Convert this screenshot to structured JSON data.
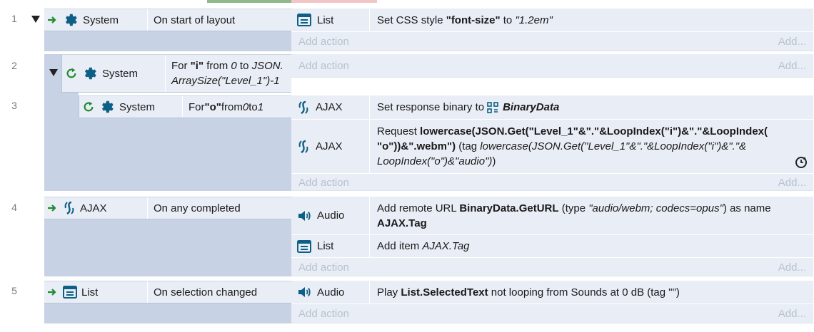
{
  "events": [
    {
      "num": "1",
      "condition": {
        "object": "System",
        "text": "On start of layout"
      },
      "actions": [
        {
          "object": "List",
          "prefix": "Set CSS style ",
          "prop": "\"font-size\"",
          "mid": " to ",
          "val": "\"1.2em\""
        }
      ]
    },
    {
      "num": "2",
      "condition": {
        "object": "System",
        "text_a": "For ",
        "var": "\"i\"",
        "text_b": " from ",
        "from": "0",
        "text_c": " to ",
        "to_line1": "JSON.",
        "to_line2": "ArraySize(\"Level_1\")-1"
      }
    },
    {
      "num": "3",
      "condition": {
        "object": "System",
        "text_a": "For ",
        "var": "\"o\"",
        "text_b": " from ",
        "from": "0",
        "text_c": " to ",
        "to": "1"
      },
      "actions": [
        {
          "object": "AJAX",
          "prefix": "Set response binary to ",
          "target": "BinaryData"
        },
        {
          "object": "AJAX",
          "prefix": "Request ",
          "expr1": "lowercase(JSON.Get(\"Level_1\"&\".\"&LoopIndex(\"i\")&\".\"&LoopIndex(",
          "expr2": "\"o\"))&\".webm\")",
          "tag_pre": " (tag ",
          "tag1": "lowercase(JSON.Get(\"Level_1\"&\".\"&LoopIndex(\"i\")&\".\"&",
          "tag2": "LoopIndex(\"o\")&\"audio\")",
          "tag_post": ")"
        }
      ]
    },
    {
      "num": "4",
      "condition": {
        "object": "AJAX",
        "text": "On any completed"
      },
      "actions": [
        {
          "object": "Audio",
          "prefix": "Add remote URL ",
          "url": "BinaryData.GetURL",
          "type_pre": " (type ",
          "type": "\"audio/webm; codecs=opus\"",
          "type_post": ") as name",
          "name": "AJAX.Tag"
        },
        {
          "object": "List",
          "prefix": "Add item ",
          "item": "AJAX.Tag"
        }
      ]
    },
    {
      "num": "5",
      "condition": {
        "object": "List",
        "text": "On selection changed"
      },
      "actions": [
        {
          "object": "Audio",
          "prefix": "Play ",
          "sound": "List.SelectedText",
          "rest": " not looping from Sounds at 0 dB (tag \"\")"
        }
      ]
    }
  ],
  "add_action": "Add action",
  "add_more": "Add..."
}
